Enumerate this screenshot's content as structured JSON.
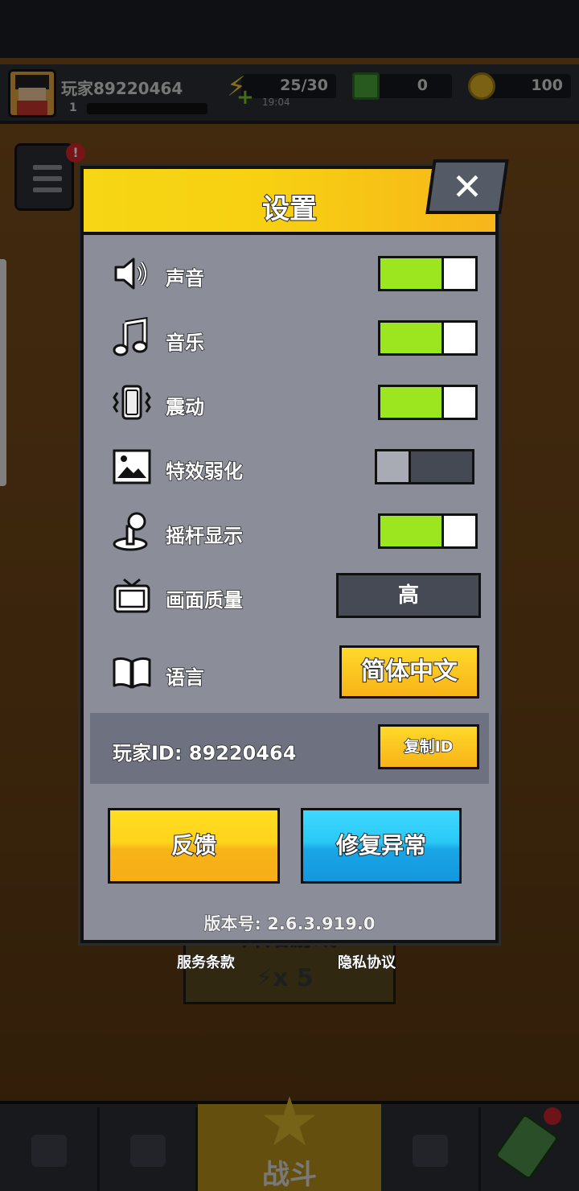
{
  "hud": {
    "player_name": "玩家89220464",
    "level": "1",
    "energy": "25/30",
    "energy_timer": "19:04",
    "gems": "0",
    "coins": "100"
  },
  "background": {
    "start_button_text": "开始游戏",
    "start_cost": "⚡x 5",
    "battle_label": "战斗"
  },
  "settings": {
    "title": "设置",
    "close_glyph": "✕",
    "rows": [
      {
        "label": "声音",
        "icon": "speaker-icon",
        "state": "on"
      },
      {
        "label": "音乐",
        "icon": "music-note-icon",
        "state": "on"
      },
      {
        "label": "震动",
        "icon": "vibration-icon",
        "state": "on"
      },
      {
        "label": "特效弱化",
        "icon": "image-icon",
        "state": "off"
      },
      {
        "label": "摇杆显示",
        "icon": "joystick-icon",
        "state": "on"
      },
      {
        "label": "画面质量",
        "icon": "tv-icon",
        "value": "高"
      },
      {
        "label": "语言",
        "icon": "book-icon",
        "value": "简体中文"
      }
    ],
    "player_id_label": "玩家ID: 89220464",
    "copy_id_label": "复制ID",
    "feedback_label": "反馈",
    "repair_label": "修复异常",
    "version": "版本号: 2.6.3.919.0"
  },
  "links": {
    "terms": "服务条款",
    "privacy": "隐私协议"
  },
  "colors": {
    "toggle_on": "#9be61e",
    "header_yellow": "#f6d615",
    "repair_blue": "#29c8f6"
  }
}
